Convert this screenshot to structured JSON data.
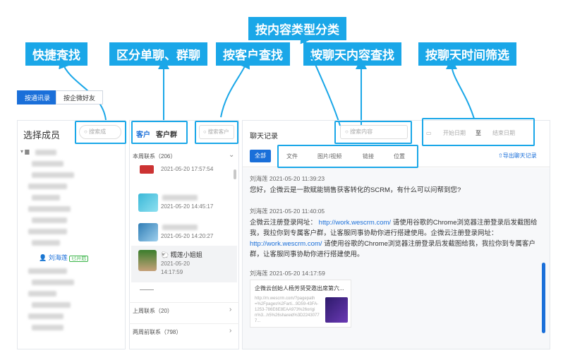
{
  "callouts": {
    "quick_search": "快捷查找",
    "split_chat": "区分单聊、群聊",
    "by_customer": "按客户查找",
    "by_content_type": "按内容类型分类",
    "by_chat_content": "按聊天内容查找",
    "by_time": "按聊天时间筛选"
  },
  "top_tabs": {
    "by_roster": "按通讯录",
    "by_wecom_friend": "按企微好友"
  },
  "left": {
    "title": "选择成员",
    "search_placeholder": "搜索成",
    "selected_member": "刘海莲",
    "selected_badge": "已开启"
  },
  "middle": {
    "tab_customer": "客户",
    "tab_group": "客户群",
    "search_placeholder": "搜索客户",
    "this_week": "本周联系（206）",
    "last_week": "上周联系（20）",
    "two_weeks_ago": "两周前联系（798）",
    "items": [
      {
        "time": "2021-05-20 17:57:54",
        "name": ""
      },
      {
        "time": "2021-05-20 14:45:17",
        "name": ""
      },
      {
        "time": "2021-05-20 14:20:27",
        "name": ""
      },
      {
        "time": "2021-05-20 14:17:59",
        "name": "🐑 糯莲小姐姐"
      }
    ]
  },
  "right": {
    "title": "聊天记录",
    "search_placeholder": "搜索内容",
    "start_date": "开始日期",
    "to": "至",
    "end_date": "结束日期",
    "filters": [
      "全部",
      "文件",
      "图片/视频",
      "链接",
      "位置"
    ],
    "export": "导出聊天记录",
    "messages": [
      {
        "meta": "刘海莲 2021-05-20 11:39:23",
        "text": "您好，企微云是一款赋能销售获客转化的SCRM，有什么可以问帮到您?"
      },
      {
        "meta": "刘海莲 2021-05-20 11:40:05",
        "text_a": "企微云注册登录网址：",
        "link_a": "http://work.wescrm.com/",
        "text_b": "请使用谷歌的Chrome浏览器注册登录后发截图给我，我拉你到专属客户群，让客服同事协助你进行搭建使用。企微云注册登录网址：",
        "link_b": "http://work.wescrm.com/",
        "text_c": "请使用谷歌的Chrome浏览器注册登录后发截图给我，我拉你到专属客户群，让客服同事协助你进行搭建使用。"
      },
      {
        "meta": "刘海莲 2021-05-20 14:17:59",
        "card_title": "企微云创始人杨芳贤受邀出席第六...",
        "card_url": "http://m.wescrm.com/?pagepath=%2Fpages%2Farti...9D59-43FA-1253-786E6E8EAA973%26origin%3...h5%26shareid%3D22430777..."
      }
    ]
  },
  "colors": {
    "accent": "#1aa7e8",
    "primary": "#1a6fd9"
  }
}
